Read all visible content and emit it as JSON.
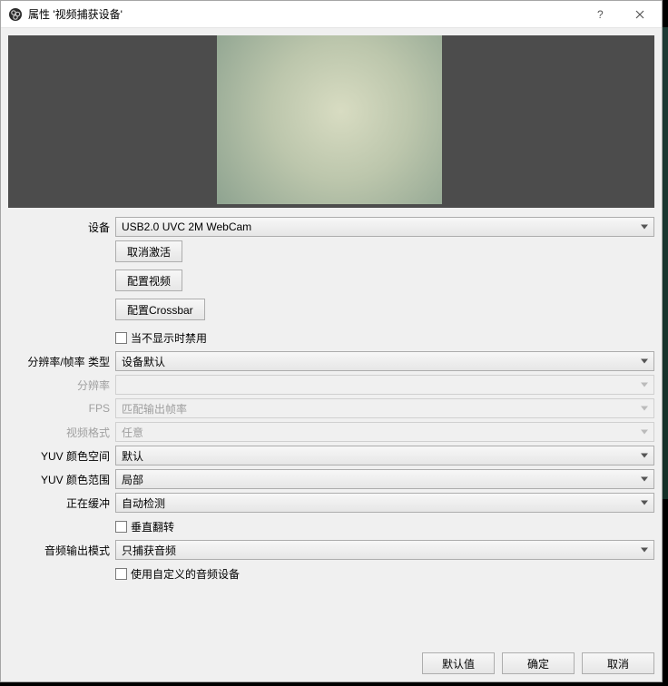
{
  "titlebar": {
    "title": "属性 '视频捕获设备'"
  },
  "form": {
    "device_label": "设备",
    "device_value": "USB2.0 UVC 2M WebCam",
    "deactivate_btn": "取消激活",
    "config_video_btn": "配置视频",
    "config_crossbar_btn": "配置Crossbar",
    "deactivate_when_hidden": "当不显示时禁用",
    "restype_label": "分辨率/帧率 类型",
    "restype_value": "设备默认",
    "resolution_label": "分辨率",
    "resolution_value": "",
    "fps_label": "FPS",
    "fps_value": "匹配输出帧率",
    "videoformat_label": "视频格式",
    "videoformat_value": "任意",
    "yuv_space_label": "YUV 颜色空间",
    "yuv_space_value": "默认",
    "yuv_range_label": "YUV 颜色范围",
    "yuv_range_value": "局部",
    "buffering_label": "正在缓冲",
    "buffering_value": "自动检测",
    "flip_vertical": "垂直翻转",
    "audio_output_label": "音频输出模式",
    "audio_output_value": "只捕获音频",
    "use_custom_audio": "使用自定义的音频设备"
  },
  "footer": {
    "defaults": "默认值",
    "ok": "确定",
    "cancel": "取消"
  }
}
